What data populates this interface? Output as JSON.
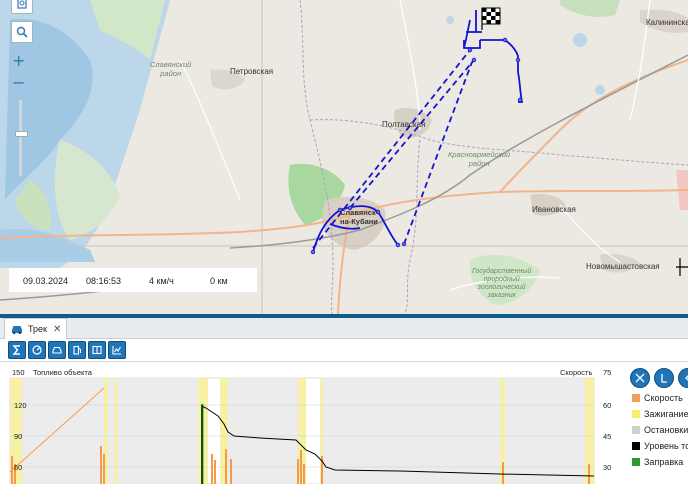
{
  "map": {
    "labels": {
      "slavyansky_region": "Славянский\nрайон",
      "petrovskaya": "Петровская",
      "poltavskaya": "Полтавская",
      "krasnoarmeisky_region": "Красноармейский\nрайон",
      "slavyansk": "Славянск-\nна-Кубани",
      "ivanovskaya": "Ивановская",
      "novomyshastovskaya": "Новомышастовская",
      "kalininskaya": "Калининская",
      "reserve": "Государственный\nприродный\nзоологический\nзаказник"
    },
    "controls": {
      "print_icon": "printer-icon",
      "search_icon": "search-icon",
      "zoom_in": "+",
      "zoom_out": "−"
    },
    "status": {
      "date": "09.03.2024",
      "time": "08:16:53",
      "speed": "4 км/ч",
      "distance": "0 км"
    }
  },
  "panel": {
    "tab_label": "Трек",
    "tab_close": "✕",
    "toolbar_icons": [
      "sigma-icon",
      "speed-icon",
      "car-icon",
      "fuel-icon",
      "split-icon",
      "chart-icon"
    ]
  },
  "chart": {
    "left_axis_title": "Топливо объекта",
    "right_axis_title": "Скорость",
    "left_max": "150",
    "right_max": "75",
    "left_ticks": [
      "120",
      "90",
      "60"
    ],
    "right_ticks": [
      "60",
      "45",
      "30"
    ]
  },
  "chart_data": {
    "type": "line",
    "title": "",
    "ylabel_left": "Топливо объекта",
    "ylabel_right": "Скорость",
    "ylim_left": [
      0,
      150
    ],
    "ylim_right": [
      0,
      75
    ],
    "series": [
      {
        "name": "Уровень топлива",
        "color": "#000000"
      },
      {
        "name": "Скорость",
        "color": "#f59a4a"
      }
    ]
  },
  "legend": {
    "items": [
      {
        "label": "Скорость",
        "color": "#f5a05a"
      },
      {
        "label": "Зажигание",
        "color": "#f5ef6a"
      },
      {
        "label": "Остановки",
        "color": "#cfcfcf"
      },
      {
        "label": "Уровень топлива",
        "color": "#000000"
      },
      {
        "label": "Заправка",
        "color": "#2e9a2e"
      }
    ],
    "buttons": [
      "expand-icon",
      "zoom-fit-icon",
      "back-icon"
    ]
  }
}
